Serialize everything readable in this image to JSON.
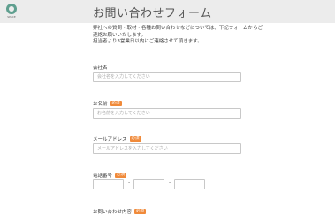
{
  "header": {
    "title": "お問い合わせフォーム",
    "logo_text": "SPACE"
  },
  "intro": {
    "line1": "弊社への質問・取材・各種お問い合わせなどについては、下記フォームからご",
    "line2": "連絡お願いいたします。",
    "line3": "担当者より3営業日以内にご連絡させて頂きます。"
  },
  "form": {
    "company": {
      "label": "会社名",
      "placeholder": "会社名を入力してください"
    },
    "name": {
      "label": "お名前",
      "required": "必須",
      "placeholder": "お名前を入力してください"
    },
    "email": {
      "label": "メールアドレス",
      "required": "必須",
      "placeholder": "メールアドレスを入力してください"
    },
    "phone": {
      "label": "電話番号",
      "required": "必須",
      "separator": "-"
    },
    "inquiry": {
      "label": "お問い合わせ内容",
      "required": "必須"
    }
  },
  "colors": {
    "required_badge": "#f08a3a",
    "header_bg": "#ececec"
  }
}
